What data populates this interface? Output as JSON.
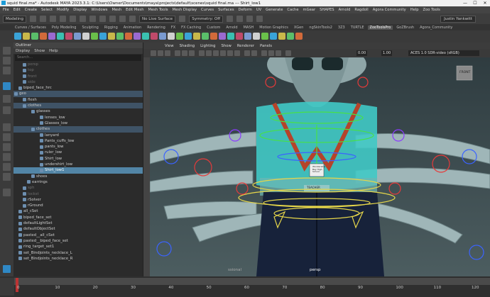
{
  "window": {
    "title": "squid final.ma* - Autodesk MAYA 2023.3.1: C:\\Users\\Owner\\Documents\\maya\\projects\\default\\scenes\\squid final.ma   ---   Shirt_low1",
    "minimize": "—",
    "maximize": "☐",
    "close": "✕"
  },
  "menubar": [
    "File",
    "Edit",
    "Create",
    "Select",
    "Modify",
    "Display",
    "Windows",
    "Mesh",
    "Edit Mesh",
    "Mesh Tools",
    "Mesh Display",
    "Curves",
    "Surfaces",
    "Deform",
    "UV",
    "Generate",
    "Cache",
    "mGear",
    "SHAPES",
    "Arnold",
    "Ragdoll",
    "Agora Community",
    "Help",
    "Zoo Tools"
  ],
  "statusline": {
    "mode": "Modeling",
    "live_surface": "No Live Surface",
    "symmetry": "Symmetry: Off",
    "user": "Justin Yankwitt"
  },
  "shelf_tabs": [
    "Curves / Surfaces",
    "Poly Modeling",
    "Sculpting",
    "Rigging",
    "Animation",
    "Rendering",
    "FX",
    "FX Caching",
    "Custom",
    "Arnold",
    "MASH",
    "Motion Graphics",
    "XGen",
    "ngSkinTools2",
    "3Z3",
    "TURTLE",
    "ZooToolsPro",
    "GoZBrush",
    "Agora_Community"
  ],
  "shelf_active": "ZooToolsPro",
  "outliner": {
    "title": "Outliner",
    "menu": [
      "Display",
      "Show",
      "Help"
    ],
    "search_placeholder": "Search...",
    "items": [
      {
        "label": "persp",
        "indent": 20,
        "style": "dim"
      },
      {
        "label": "top",
        "indent": 20,
        "style": "dim"
      },
      {
        "label": "front",
        "indent": 20,
        "style": "dim"
      },
      {
        "label": "side",
        "indent": 20,
        "style": "dim"
      },
      {
        "label": "biped_face_hrc",
        "indent": 14,
        "style": ""
      },
      {
        "label": "geo",
        "indent": 8,
        "style": "hl"
      },
      {
        "label": "flesh",
        "indent": 20,
        "style": ""
      },
      {
        "label": "clothes",
        "indent": 20,
        "style": "hl"
      },
      {
        "label": "glasses",
        "indent": 32,
        "style": ""
      },
      {
        "label": "lenses_low",
        "indent": 44,
        "style": ""
      },
      {
        "label": "Glasses_low",
        "indent": 44,
        "style": ""
      },
      {
        "label": "clothes",
        "indent": 32,
        "style": "hl"
      },
      {
        "label": "lanyard",
        "indent": 44,
        "style": ""
      },
      {
        "label": "Pants_cuffs_low",
        "indent": 44,
        "style": ""
      },
      {
        "label": "pants_low",
        "indent": 44,
        "style": ""
      },
      {
        "label": "ruler_low",
        "indent": 44,
        "style": ""
      },
      {
        "label": "Shirt_low",
        "indent": 44,
        "style": ""
      },
      {
        "label": "undershirt_low",
        "indent": 44,
        "style": ""
      },
      {
        "label": "Shirt_low1",
        "indent": 44,
        "style": "sel"
      },
      {
        "label": "shoes",
        "indent": 32,
        "style": ""
      },
      {
        "label": "earrings",
        "indent": 26,
        "style": ""
      },
      {
        "label": "sph",
        "indent": 20,
        "style": "dim"
      },
      {
        "label": "lockst",
        "indent": 20,
        "style": "dim"
      },
      {
        "label": "rSolver",
        "indent": 20,
        "style": ""
      },
      {
        "label": "rGround",
        "indent": 20,
        "style": ""
      },
      {
        "label": "all_cSet",
        "indent": 14,
        "style": ""
      },
      {
        "label": "biped_face_set",
        "indent": 14,
        "style": ""
      },
      {
        "label": "defaultLightSet",
        "indent": 14,
        "style": ""
      },
      {
        "label": "defaultObjectSet",
        "indent": 14,
        "style": ""
      },
      {
        "label": "pasted__all_cSet",
        "indent": 14,
        "style": ""
      },
      {
        "label": "pasted__biped_face_set",
        "indent": 14,
        "style": ""
      },
      {
        "label": "ring_target_set1",
        "indent": 14,
        "style": ""
      },
      {
        "label": "set_Bindjoints_necklace_L",
        "indent": 14,
        "style": ""
      },
      {
        "label": "set_Bindjoints_necklace_R",
        "indent": 14,
        "style": ""
      }
    ]
  },
  "viewport": {
    "menu": [
      "View",
      "Shading",
      "Lighting",
      "Show",
      "Renderer",
      "Panels"
    ],
    "field_a": "0.00",
    "field_b": "1.00",
    "colorspace": "ACES 1.0 SDR-video (sRGB)",
    "view_cube_label": "FRONT",
    "camera_label": "persp",
    "hud_left": "ssional",
    "badge_top": "Wonderstrip Bay High School",
    "badge_bottom": "TEACHER"
  },
  "timeline": {
    "ticks": [
      "0",
      "10",
      "20",
      "30",
      "40",
      "50",
      "60",
      "70",
      "80",
      "90",
      "100",
      "110",
      "120"
    ]
  },
  "colors": {
    "accent": "#2f88c5",
    "selection": "#5285a6",
    "viewport_bg": "#3a4a4e"
  }
}
